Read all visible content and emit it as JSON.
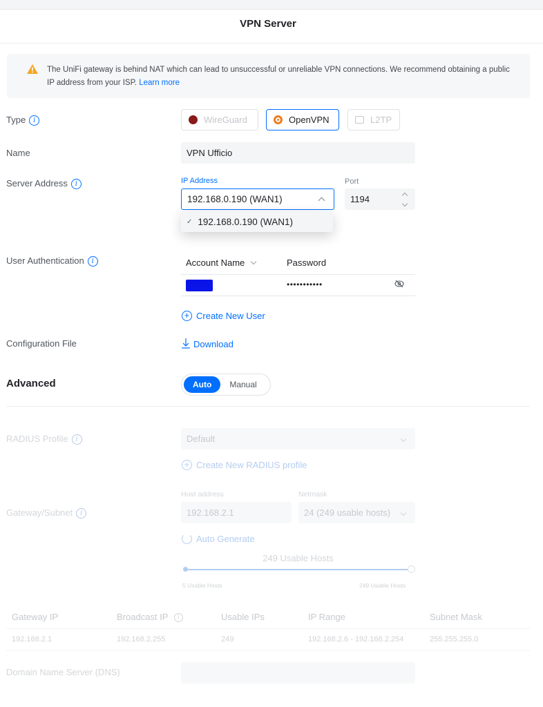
{
  "title": "VPN Server",
  "alert": {
    "text": "The UniFi gateway is behind NAT which can lead to unsuccessful or unreliable VPN connections. We recommend obtaining a public IP address from your ISP.",
    "link": "Learn more"
  },
  "type": {
    "label": "Type",
    "options": [
      "WireGuard",
      "OpenVPN",
      "L2TP"
    ],
    "selected": "OpenVPN"
  },
  "name": {
    "label": "Name",
    "value": "VPN Ufficio"
  },
  "server_address": {
    "label": "Server Address",
    "ip_label": "IP Address",
    "ip_value": "192.168.0.190 (WAN1)",
    "dropdown_option": "192.168.0.190 (WAN1)",
    "port_label": "Port",
    "port_value": "1194"
  },
  "user_auth": {
    "label": "User Authentication",
    "col_account": "Account Name",
    "col_password": "Password",
    "password_mask": "•••••••••••",
    "create_user": "Create New User"
  },
  "config_file": {
    "label": "Configuration File",
    "download": "Download"
  },
  "advanced": {
    "label": "Advanced",
    "options": [
      "Auto",
      "Manual"
    ],
    "selected": "Auto"
  },
  "radius": {
    "label": "RADIUS Profile",
    "value": "Default",
    "create": "Create New RADIUS profile"
  },
  "gateway": {
    "label": "Gateway/Subnet",
    "host_label": "Host address",
    "host_value": "192.168.2.1",
    "netmask_label": "Netmask",
    "netmask_value": "24 (249 usable hosts)",
    "auto_generate": "Auto Generate",
    "slider_title": "249 Usable Hosts",
    "slider_min": "5 Usable Hosts",
    "slider_max": "249 Usable Hosts",
    "slider_level": 1.0
  },
  "table": {
    "headers": [
      "Gateway IP",
      "Broadcast IP",
      "Usable IPs",
      "IP Range",
      "Subnet Mask"
    ],
    "row": [
      "192.168.2.1",
      "192.168.2.255",
      "249",
      "192.168.2.6 - 192.168.2.254",
      "255.255.255.0"
    ]
  },
  "dns": {
    "label": "Domain Name Server (DNS)"
  },
  "colors": {
    "accent": "#006fff",
    "warning": "#f5a623",
    "redacted": "#0a14e8"
  }
}
